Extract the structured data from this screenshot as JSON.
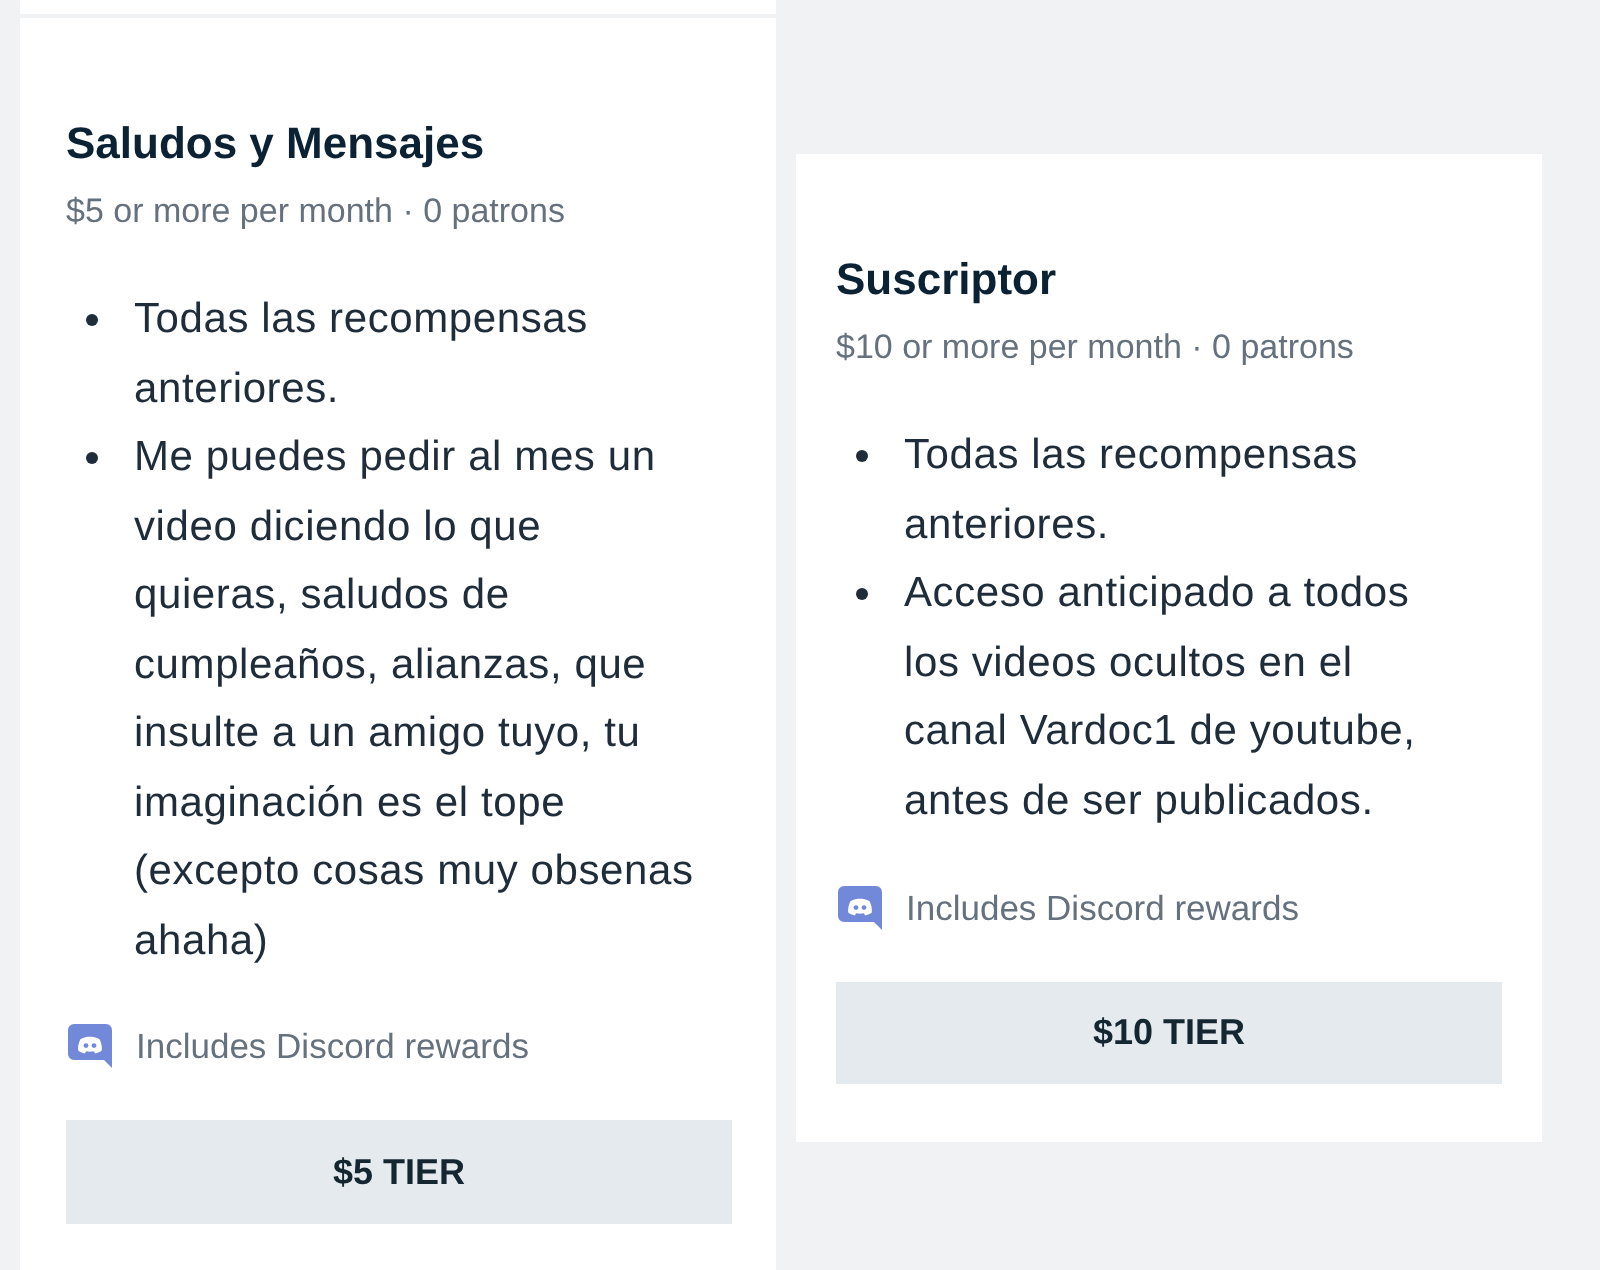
{
  "tiers": [
    {
      "title": "Saludos y Mensajes",
      "subtitle": "$5 or more per month · 0 patrons",
      "benefits": [
        "Todas las recompensas anteriores.",
        "Me puedes pedir al mes un video diciendo lo que quieras, saludos de cumpleaños, alianzas, que insulte a un amigo tuyo, tu imaginación es el tope (excepto cosas muy obsenas ahaha)"
      ],
      "discord": {
        "label": "Includes Discord rewards"
      },
      "button": "$5 TIER"
    },
    {
      "title": "Suscriptor",
      "subtitle": "$10 or more per month · 0 patrons",
      "benefits": [
        "Todas las recompensas anteriores.",
        "Acceso anticipado a todos los videos ocultos en el canal Vardoc1 de youtube, antes de ser publicados."
      ],
      "discord": {
        "label": "Includes Discord rewards"
      },
      "button": "$10 TIER"
    }
  ]
}
